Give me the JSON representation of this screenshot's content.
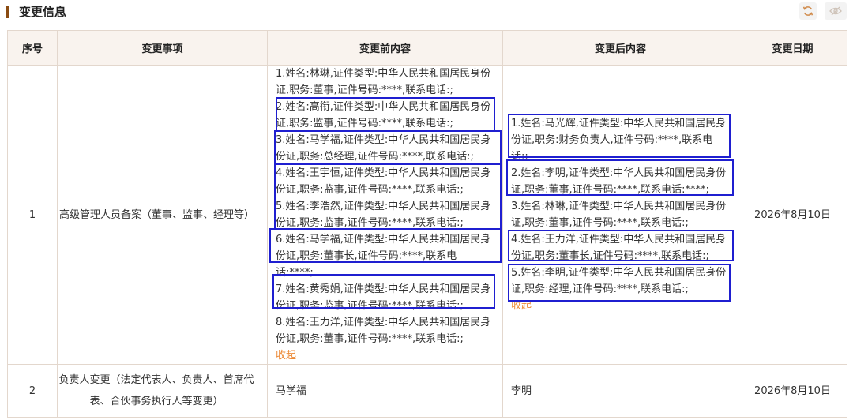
{
  "section": {
    "title": "变更信息",
    "refresh_icon": "refresh-icon",
    "eye_icon": "eye-slash-icon"
  },
  "table": {
    "headers": [
      "序号",
      "变更事项",
      "变更前内容",
      "变更后内容",
      "变更日期"
    ],
    "rows": [
      {
        "index": "1",
        "item": "高级管理人员备案（董事、监事、经理等）",
        "before": [
          "1.姓名:林琳,证件类型:中华人民共和国居民身份证,职务:董事,证件号码:****,联系电话:;",
          "2.姓名:高衔,证件类型:中华人民共和国居民身份证,职务:监事,证件号码:****,联系电话:;",
          "3.姓名:马学福,证件类型:中华人民共和国居民身份证,职务:总经理,证件号码:****,联系电话:;",
          "4.姓名:王宇恒,证件类型:中华人民共和国居民身份证,职务:监事,证件号码:****,联系电话:;",
          "5.姓名:李浩然,证件类型:中华人民共和国居民身份证,职务:监事,证件号码:****,联系电话:;",
          "6.姓名:马学福,证件类型:中华人民共和国居民身份证,职务:董事长,证件号码:****,联系电话:****;",
          "7.姓名:黄秀娟,证件类型:中华人民共和国居民身份证,职务:监事,证件号码:****,联系电话:;",
          "8.姓名:王力洋,证件类型:中华人民共和国居民身份证,职务:董事,证件号码:****,联系电话:;"
        ],
        "before_toggle": "收起",
        "after": [
          "1.姓名:马光辉,证件类型:中华人民共和国居民身份证,职务:财务负责人,证件号码:****,联系电话:;",
          "2.姓名:李明,证件类型:中华人民共和国居民身份证,职务:董事,证件号码:****,联系电话:****;",
          "3.姓名:林琳,证件类型:中华人民共和国居民身份证,职务:董事,证件号码:****,联系电话:;",
          "4.姓名:王力洋,证件类型:中华人民共和国居民身份证,职务:董事长,证件号码:****,联系电话:;",
          "5.姓名:李明,证件类型:中华人民共和国居民身份证,职务:经理,证件号码:****,联系电话:;"
        ],
        "after_toggle": "收起",
        "date": "2026年8月10日"
      },
      {
        "index": "2",
        "item": "负责人变更（法定代表人、负责人、首席代表、合伙事务执行人等变更）",
        "before": "马学福",
        "after": "李明",
        "date": "2026年8月10日"
      }
    ]
  },
  "colors": {
    "border": "#e3d7cd",
    "header_bg": "#f9f3ee",
    "accent": "#ec8a37",
    "highlight": "#1f1fd0",
    "title_bar": "#8a4b12"
  }
}
